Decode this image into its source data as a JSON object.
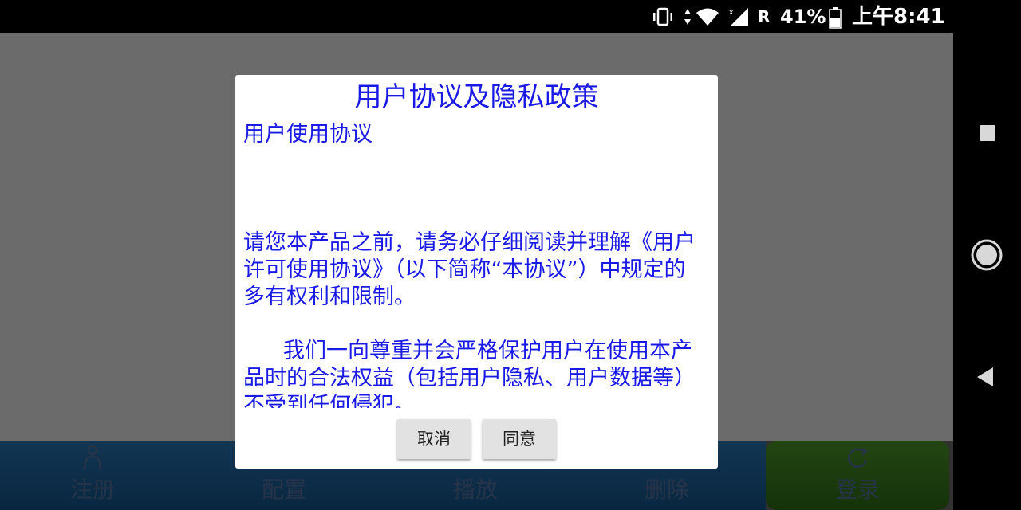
{
  "status_bar": {
    "roaming": "R",
    "battery": "41%",
    "time": "上午8:41"
  },
  "dialog": {
    "title": "用户协议及隐私政策",
    "heading": "用户使用协议",
    "paragraph1": "请您本产品之前，请务必仔细阅读并理解《用户许可使用协议》（以下简称“本协议”）中规定的多有权利和限制。",
    "paragraph2": "我们一向尊重并会严格保护用户在使用本产品时的合法权益（包括用户隐私、用户数据等）不受到任何侵犯。",
    "cancel_label": "取消",
    "agree_label": "同意"
  },
  "bottom_bar": {
    "register_label": "注册",
    "config_label": "配置",
    "play_label": "播放",
    "delete_label": "删除",
    "login_label": "登录"
  },
  "colors": {
    "dialog_text": "#1a1ae6",
    "overlay": "#6b6b6b",
    "login_button": "#3a7a1c",
    "bottom_bar": "#1b6aa8"
  },
  "icons": {
    "register": "person-icon",
    "login": "refresh-icon",
    "nav_recents": "square-icon",
    "nav_home": "circle-icon",
    "nav_back": "triangle-back-icon"
  }
}
